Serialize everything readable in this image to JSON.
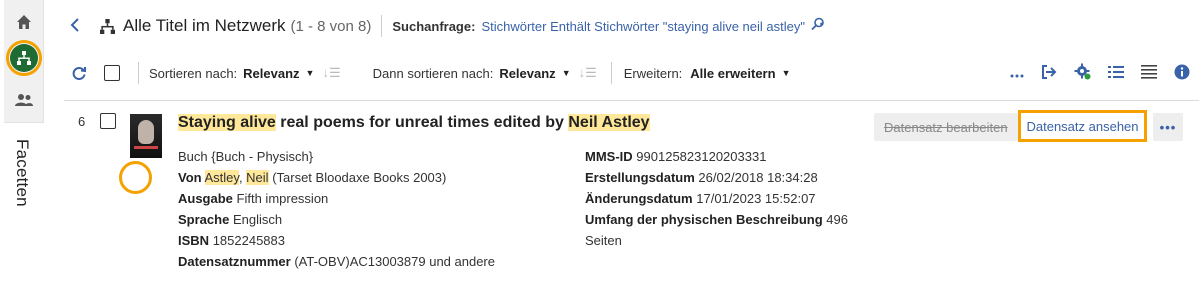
{
  "rail": {
    "facets_label": "Facetten"
  },
  "header": {
    "title": "Alle Titel im Netzwerk",
    "count": "(1 - 8 von 8)",
    "search_query_label": "Suchanfrage:",
    "search_query_value": "Stichwörter Enthält Stichwörter \"staying alive neil astley\""
  },
  "toolbar": {
    "sort_by_label": "Sortieren nach:",
    "sort_by_value": "Relevanz",
    "then_sort_label": "Dann sortieren nach:",
    "then_sort_value": "Relevanz",
    "expand_label": "Erweitern:",
    "expand_value": "Alle erweitern"
  },
  "record": {
    "number": "6",
    "title_hl1": "Staying alive",
    "title_mid": " real poems for unreal times edited by ",
    "title_hl2": "Neil Astley",
    "edit_button": "Datensatz bearbeiten",
    "view_button": "Datensatz ansehen",
    "more_button": "•••",
    "type": "Buch {Buch - Physisch}",
    "by_label": "Von",
    "author_last": "Astley",
    "author_sep": ", ",
    "author_first": "Neil",
    "publisher": " (Tarset Bloodaxe Books 2003)",
    "edition_label": "Ausgabe",
    "edition_value": "Fifth impression",
    "language_label": "Sprache",
    "language_value": "Englisch",
    "isbn_label": "ISBN",
    "isbn_value": "1852245883",
    "record_number_label": "Datensatznummer",
    "record_number_value": "(AT-OBV)AC13003879 und andere",
    "mms_label": "MMS-ID",
    "mms_value": "990125823120203331",
    "created_label": "Erstellungsdatum",
    "created_value": "26/02/2018 18:34:28",
    "modified_label": "Änderungsdatum",
    "modified_value": "17/01/2023 15:52:07",
    "extent_label": "Umfang der physischen Beschreibung",
    "extent_value": "496",
    "extent_cont": "Seiten"
  },
  "colors": {
    "accent_orange": "#f5a100",
    "link_blue": "#3a62a8",
    "rail_green": "#1e6b33",
    "highlight": "#ffe89a"
  }
}
